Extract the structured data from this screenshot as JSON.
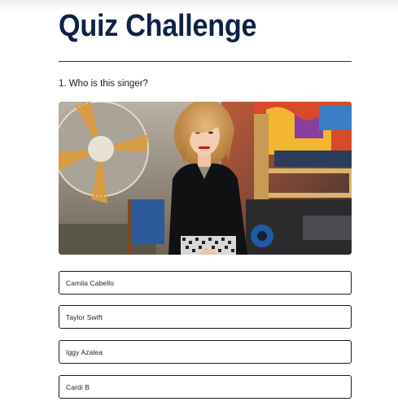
{
  "quiz": {
    "title": "Quiz Challenge",
    "question": {
      "text": "1. Who is this singer?",
      "image_alt": "Singer photo",
      "options": [
        {
          "label": "Camila Cabello"
        },
        {
          "label": "Taylor Swift"
        },
        {
          "label": "Iggy Azalea"
        },
        {
          "label": "Cardi B"
        }
      ]
    }
  },
  "colors": {
    "title": "#0f2146",
    "border": "#1b1b1b",
    "background": "#ffffff"
  }
}
